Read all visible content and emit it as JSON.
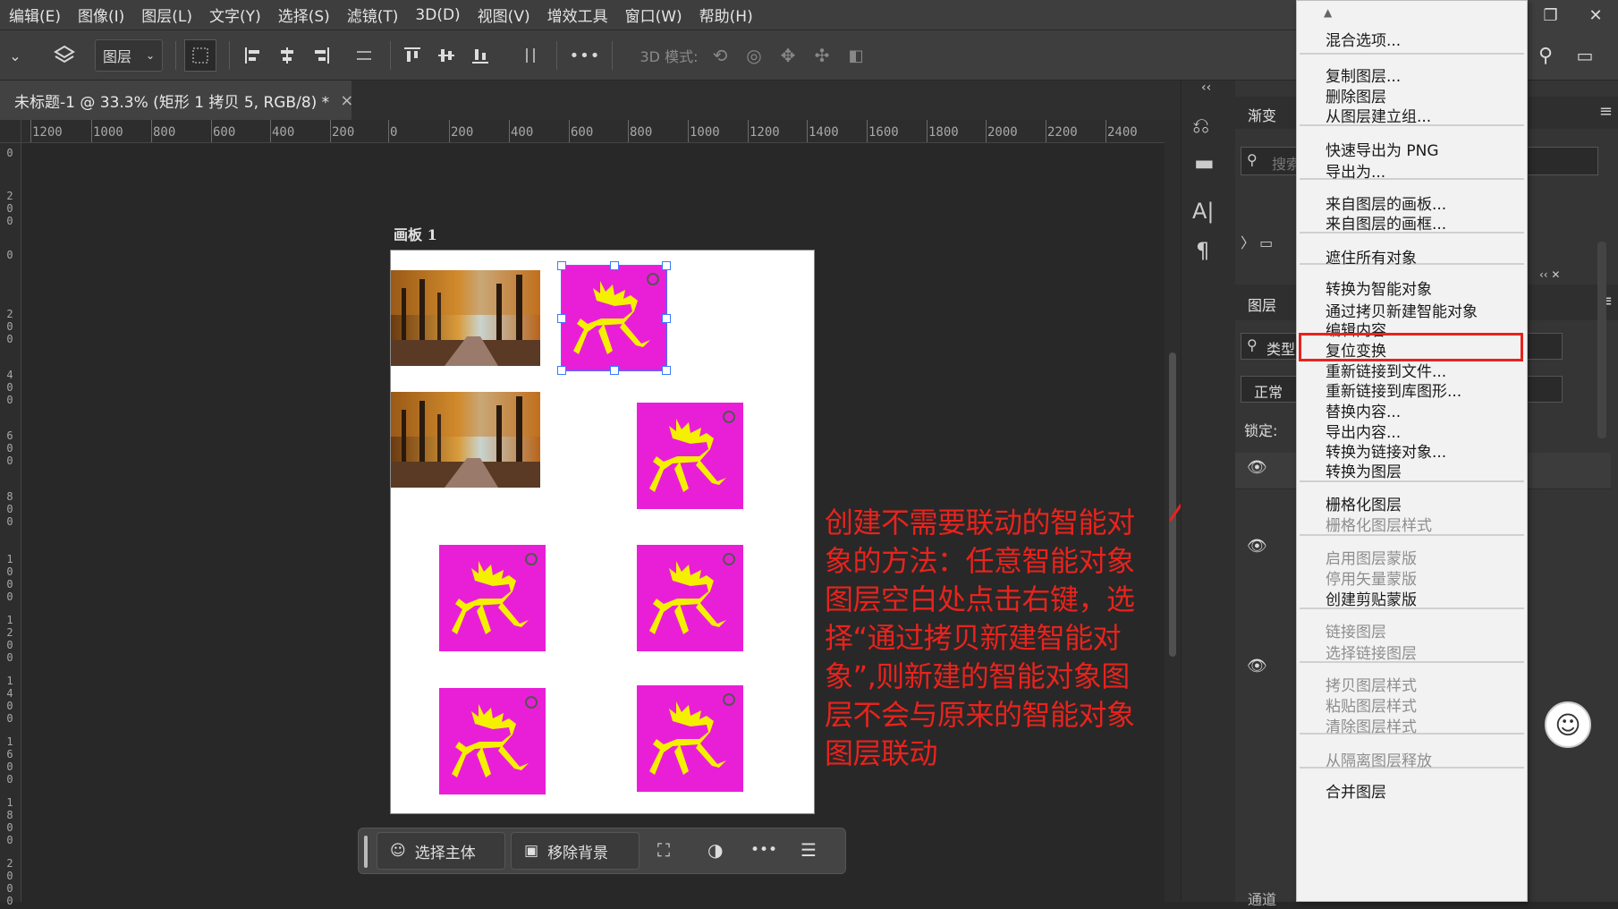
{
  "menubar": {
    "items": [
      "编辑(E)",
      "图像(I)",
      "图层(L)",
      "文字(Y)",
      "选择(S)",
      "滤镜(T)",
      "3D(D)",
      "视图(V)",
      "增效工具",
      "窗口(W)",
      "帮助(H)"
    ]
  },
  "toolbar": {
    "layer_select": "图层",
    "mode_label": "3D 模式:",
    "more": "•••"
  },
  "document_tab": {
    "title": "未标题-1 @ 33.3% (矩形 1 拷贝 5, RGB/8) *",
    "close": "×"
  },
  "ruler": {
    "h_ticks": [
      "1200",
      "1000",
      "800",
      "600",
      "400",
      "200",
      "0",
      "200",
      "400",
      "600",
      "800",
      "1000",
      "1200",
      "1400",
      "1600",
      "1800",
      "2000",
      "2200",
      "2400"
    ],
    "v_ticks": [
      "0",
      "200",
      "0",
      "200",
      "400",
      "600",
      "800",
      "1000",
      "1200",
      "1400",
      "1600",
      "1800",
      "2000"
    ]
  },
  "artboard": {
    "label": "画板 1"
  },
  "annotation": {
    "text": "创建不需要联动的智能对象的方法：任意智能对象图层空白处点击右键，选择“通过拷贝新建智能对象”,则新建的智能对象图层不会与原来的智能对象图层联动"
  },
  "contextual_taskbar": {
    "select_subject": "选择主体",
    "remove_background": "移除背景",
    "more": "•••"
  },
  "panels": {
    "gradient_tab": "渐变",
    "search_placeholder": "搜索",
    "layers_tab": "图层",
    "filter_kind": "类型",
    "blend_mode": "正常",
    "lock_label": "锁定:",
    "channels_tab": "通道"
  },
  "context_menu": {
    "items": [
      {
        "label": "混合选项...",
        "enabled": true
      },
      {
        "label": "复制图层...",
        "enabled": true
      },
      {
        "label": "删除图层",
        "enabled": true
      },
      {
        "label": "从图层建立组...",
        "enabled": true
      },
      {
        "label": "快速导出为 PNG",
        "enabled": true
      },
      {
        "label": "导出为...",
        "enabled": true
      },
      {
        "label": "来自图层的画板...",
        "enabled": true
      },
      {
        "label": "来自图层的画框...",
        "enabled": true
      },
      {
        "label": "遮住所有对象",
        "enabled": true
      },
      {
        "label": "转换为智能对象",
        "enabled": true
      },
      {
        "label": "通过拷贝新建智能对象",
        "enabled": true,
        "highlighted": true
      },
      {
        "label": "编辑内容",
        "enabled": true
      },
      {
        "label": "复位变换",
        "enabled": true
      },
      {
        "label": "重新链接到文件...",
        "enabled": true
      },
      {
        "label": "重新链接到库图形...",
        "enabled": true
      },
      {
        "label": "替换内容...",
        "enabled": true
      },
      {
        "label": "导出内容...",
        "enabled": true
      },
      {
        "label": "转换为链接对象...",
        "enabled": true
      },
      {
        "label": "转换为图层",
        "enabled": true
      },
      {
        "label": "栅格化图层",
        "enabled": true
      },
      {
        "label": "栅格化图层样式",
        "enabled": false
      },
      {
        "label": "启用图层蒙版",
        "enabled": false
      },
      {
        "label": "停用矢量蒙版",
        "enabled": false
      },
      {
        "label": "创建剪贴蒙版",
        "enabled": true
      },
      {
        "label": "链接图层",
        "enabled": false
      },
      {
        "label": "选择链接图层",
        "enabled": false
      },
      {
        "label": "拷贝图层样式",
        "enabled": false
      },
      {
        "label": "粘贴图层样式",
        "enabled": false
      },
      {
        "label": "清除图层样式",
        "enabled": false
      },
      {
        "label": "从隔离图层释放",
        "enabled": false
      },
      {
        "label": "合并图层",
        "enabled": true
      }
    ]
  },
  "colors": {
    "annotation_red": "#e8231d",
    "deer_magenta": "#e91fd8",
    "deer_yellow": "#f5f000"
  }
}
